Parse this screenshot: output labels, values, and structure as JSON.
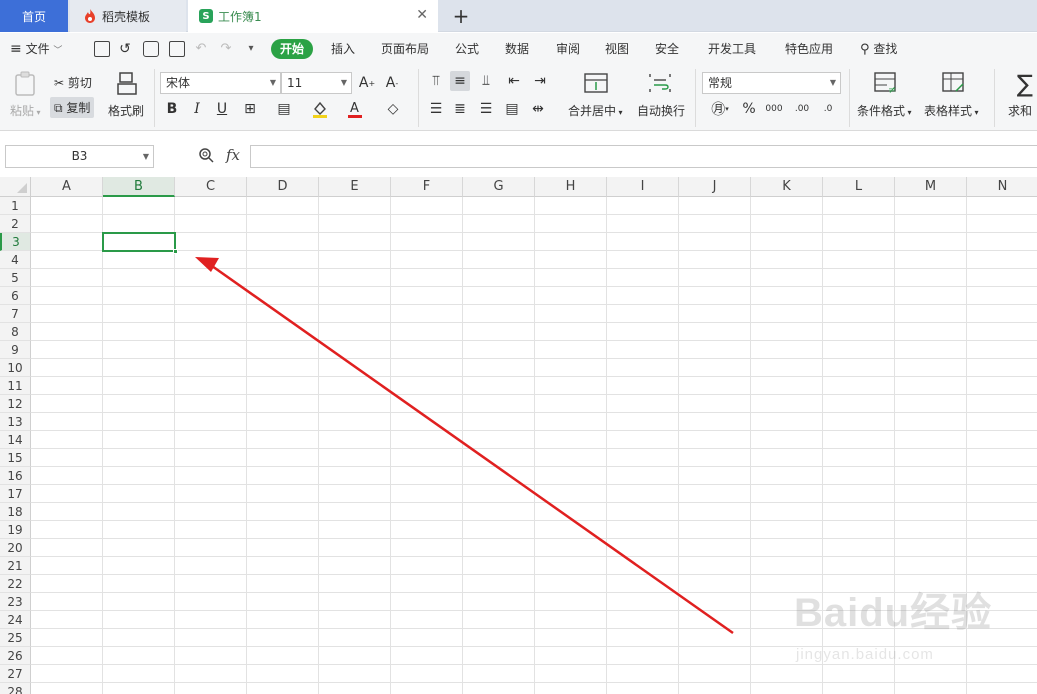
{
  "tabs": {
    "home": "首页",
    "template": "稻壳模板",
    "workbook": "工作簿1",
    "workbook_icon": "S"
  },
  "menu": {
    "file": "文件",
    "items": [
      "开始",
      "插入",
      "页面布局",
      "公式",
      "数据",
      "审阅",
      "视图",
      "安全",
      "开发工具",
      "特色应用"
    ],
    "search": "查找"
  },
  "ribbon": {
    "paste": "粘贴",
    "cut": "剪切",
    "copy": "复制",
    "format_painter": "格式刷",
    "font_name": "宋体",
    "font_size": "11",
    "bold": "B",
    "italic": "I",
    "underline": "U",
    "merge_center": "合并居中",
    "wrap_text": "自动换行",
    "number_format": "常规",
    "percent": "%",
    "conditional_format": "条件格式",
    "table_style": "表格样式",
    "sum": "求和"
  },
  "formula_bar": {
    "cell_ref": "B3",
    "fx": "fx",
    "formula": ""
  },
  "sheet": {
    "columns": [
      "A",
      "B",
      "C",
      "D",
      "E",
      "F",
      "G",
      "H",
      "I",
      "J",
      "K",
      "L",
      "M",
      "N"
    ],
    "rows": [
      "1",
      "2",
      "3",
      "4",
      "5",
      "6",
      "7",
      "8",
      "9",
      "10",
      "11",
      "12",
      "13",
      "14",
      "15",
      "16",
      "17",
      "18",
      "19",
      "20",
      "21",
      "22",
      "23",
      "24",
      "25",
      "26",
      "27",
      "28"
    ],
    "selected_column": "B",
    "selected_row": "3"
  },
  "colors": {
    "accent_green": "#2a9a48",
    "home_tab_blue": "#3d6fd8",
    "arrow_red": "#e02020"
  },
  "watermark": {
    "brand": "Baidu经验",
    "site": "jingyan.baidu.com"
  }
}
